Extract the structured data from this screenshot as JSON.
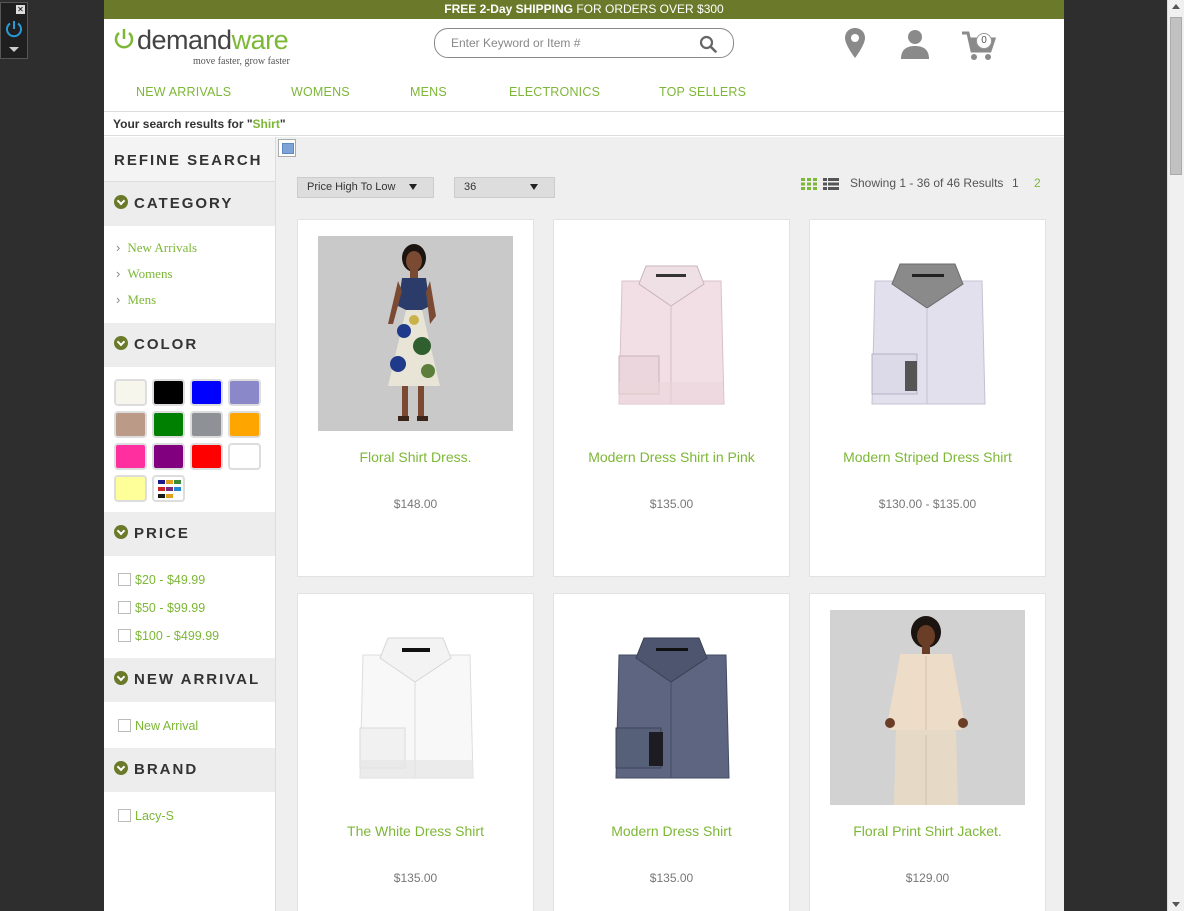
{
  "promo": {
    "strong1": "FREE 2-Day ",
    "strong2": "SHIPPING",
    "rest": " FOR ORDERS OVER $300"
  },
  "logo": {
    "brand_part1": "demand",
    "brand_part2": "ware",
    "tagline": "move faster, grow faster"
  },
  "search": {
    "placeholder": "Enter Keyword or Item #"
  },
  "header_icons": {
    "store_locator": "location-pin-icon",
    "account": "user-icon",
    "cart": "cart-icon",
    "cart_count": "0"
  },
  "nav": [
    "NEW ARRIVALS",
    "WOMENS",
    "MENS",
    "ELECTRONICS",
    "TOP SELLERS"
  ],
  "results": {
    "prefix": "Your search results for \"",
    "term": "Shirt",
    "suffix": "\""
  },
  "sidebar": {
    "refine_title": "REFINE SEARCH",
    "category_title": "CATEGORY",
    "categories": [
      "New Arrivals",
      "Womens",
      "Mens"
    ],
    "color_title": "COLOR",
    "colors": [
      "#f7f6ec",
      "#000000",
      "#0000ff",
      "#8a88c8",
      "#bc9a88",
      "#008000",
      "#8e9196",
      "#ffa500",
      "#ff2fa0",
      "#800080",
      "#ff0000",
      "#ffffff",
      "#ffff99",
      "multicolor"
    ],
    "price_title": "PRICE",
    "prices": [
      "$20 - $49.99",
      "$50 - $99.99",
      "$100 - $499.99"
    ],
    "new_arrival_title": "NEW ARRIVAL",
    "new_arrival_options": [
      "New Arrival"
    ],
    "brand_title": "BRAND",
    "brands": [
      "Lacy-S"
    ]
  },
  "toolbar": {
    "sort_selected": "Price High To Low",
    "page_size_selected": "36",
    "showing": "Showing 1 - 36 of 46 Results",
    "pages": [
      "1",
      "2"
    ],
    "current_page": "1"
  },
  "products": [
    {
      "name": "Floral Shirt Dress.",
      "price": "$148.00",
      "image": "woman-floral-dress"
    },
    {
      "name": "Modern Dress Shirt in Pink",
      "price": "$135.00",
      "image": "pink-folded-shirt"
    },
    {
      "name": "Modern Striped Dress Shirt",
      "price": "$130.00 - $135.00",
      "image": "lavender-folded-shirt"
    },
    {
      "name": "The White Dress Shirt",
      "price": "$135.00",
      "image": "white-folded-shirt"
    },
    {
      "name": "Modern Dress Shirt",
      "price": "$135.00",
      "image": "navy-folded-shirt"
    },
    {
      "name": "Floral Print Shirt Jacket.",
      "price": "$129.00",
      "image": "woman-lace-jacket"
    }
  ]
}
